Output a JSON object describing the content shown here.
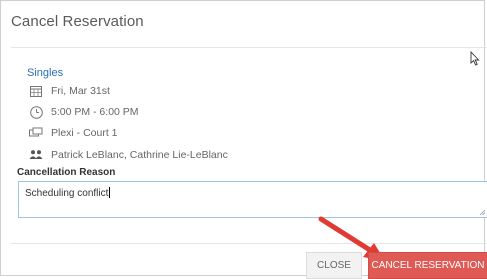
{
  "dialog": {
    "title": "Cancel Reservation"
  },
  "reservation": {
    "event_type": "Singles",
    "date": "Fri, Mar 31st",
    "time": "5:00 PM - 6:00 PM",
    "court": "Plexi - Court 1",
    "players": "Patrick LeBlanc, Cathrine Lie-LeBlanc"
  },
  "cancellation": {
    "label": "Cancellation Reason",
    "value": "Scheduling conflict"
  },
  "buttons": {
    "close": "CLOSE",
    "cancel_reservation": "CANCEL RESERVATION"
  },
  "icons": {
    "date": "calendar-icon",
    "time": "clock-icon",
    "court": "court-icon",
    "players": "players-icon"
  },
  "colors": {
    "accent_blue": "#2a6fb5",
    "cancel_button": "#e05a55",
    "annotation_arrow": "#e03a32"
  }
}
